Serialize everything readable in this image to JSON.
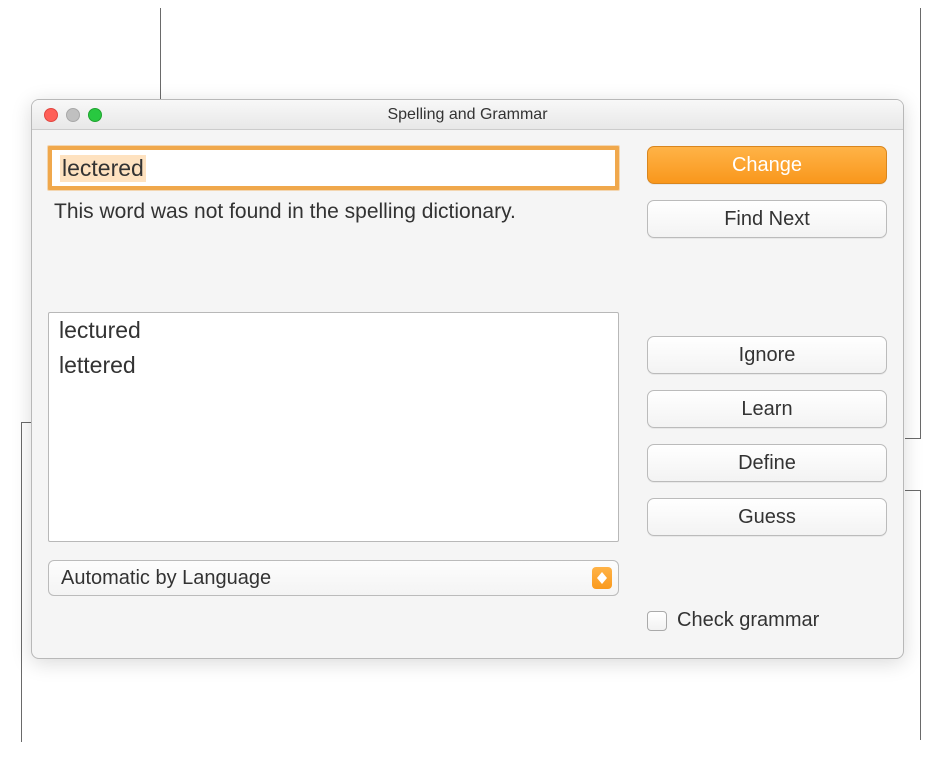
{
  "window": {
    "title": "Spelling and Grammar"
  },
  "word_field": {
    "value": "lectered"
  },
  "status_text": "This word was not found in the spelling dictionary.",
  "suggestions": [
    "lectured",
    "lettered"
  ],
  "language_select": {
    "value": "Automatic by Language"
  },
  "buttons": {
    "change": "Change",
    "find_next": "Find Next",
    "ignore": "Ignore",
    "learn": "Learn",
    "define": "Define",
    "guess": "Guess"
  },
  "check_grammar": {
    "label": "Check grammar",
    "checked": false
  }
}
